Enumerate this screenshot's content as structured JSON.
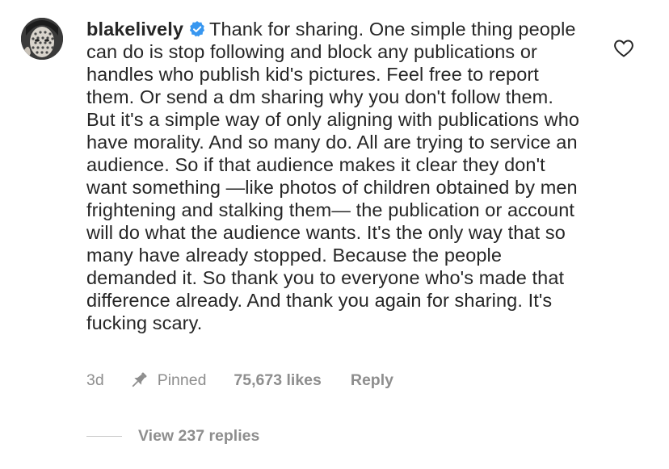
{
  "comment": {
    "username": "blakelively",
    "verified": true,
    "text": "Thank for sharing. One simple thing people can do is stop following and block any publications or handles who publish kid's pictures. Feel free to report them. Or send a dm sharing why you don't follow them. But it's a simple way of only aligning with publications who have morality. And so many do. All are trying to service an audience. So if that audience makes it clear they don't want something —like photos of children obtained by men frightening and stalking them— the publication or account will do what the audience wants. It's the only way that so many have already stopped. Because the people demanded it. So thank you to everyone who's made that difference already. And thank you again for sharing. It's fucking scary.",
    "time": "3d",
    "pinned_label": "Pinned",
    "likes": "75,673 likes",
    "reply_label": "Reply",
    "view_replies": "View 237 replies"
  },
  "colors": {
    "text": "#262626",
    "secondary": "#8e8e8e",
    "verified_blue": "#3897f0"
  },
  "icons": {
    "verified": "verified-badge-icon",
    "heart": "heart-outline-icon",
    "pin": "pin-icon"
  }
}
